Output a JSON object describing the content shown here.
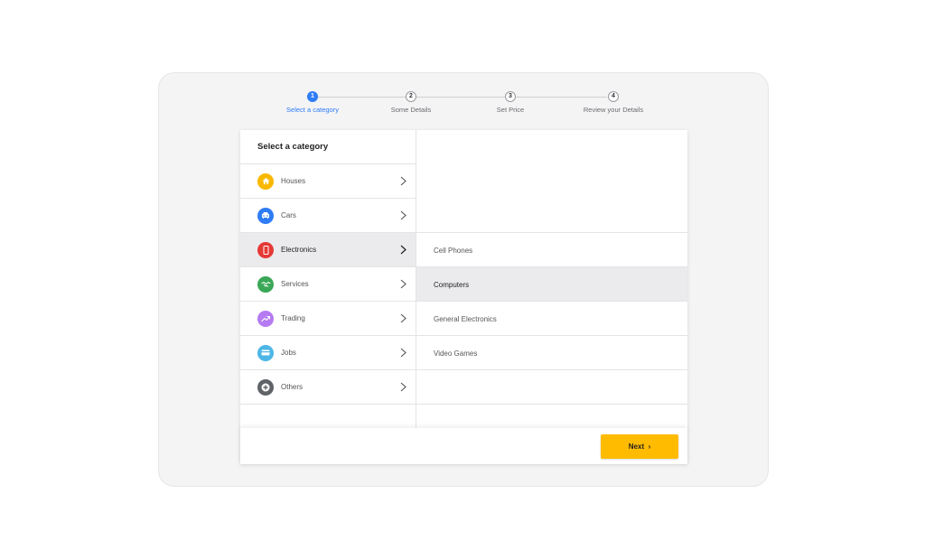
{
  "stepper": {
    "steps": [
      {
        "number": "1",
        "label": "Select a category",
        "active": true
      },
      {
        "number": "2",
        "label": "Some Details",
        "active": false
      },
      {
        "number": "3",
        "label": "Set Price",
        "active": false
      },
      {
        "number": "4",
        "label": "Review your Details",
        "active": false
      }
    ],
    "active_color": "#2f7cf6"
  },
  "categories": {
    "heading": "Select a category",
    "selected": "Electronics",
    "items": [
      {
        "label": "Houses",
        "icon": "house-icon",
        "color": "#f9b800"
      },
      {
        "label": "Cars",
        "icon": "car-icon",
        "color": "#2f7cf6"
      },
      {
        "label": "Electronics",
        "icon": "phone-icon",
        "color": "#e53935"
      },
      {
        "label": "Services",
        "icon": "handshake-icon",
        "color": "#3aa757"
      },
      {
        "label": "Trading",
        "icon": "trending-up-icon",
        "color": "#b57bf2"
      },
      {
        "label": "Jobs",
        "icon": "card-icon",
        "color": "#4db6e6"
      },
      {
        "label": "Others",
        "icon": "plus-icon",
        "color": "#5f6368"
      }
    ]
  },
  "subcategories": {
    "selected": "Computers",
    "items": [
      "Cell Phones",
      "Computers",
      "General Electronics",
      "Video Games"
    ]
  },
  "footer": {
    "next_label": "Next",
    "next_color": "#ffbb00"
  }
}
